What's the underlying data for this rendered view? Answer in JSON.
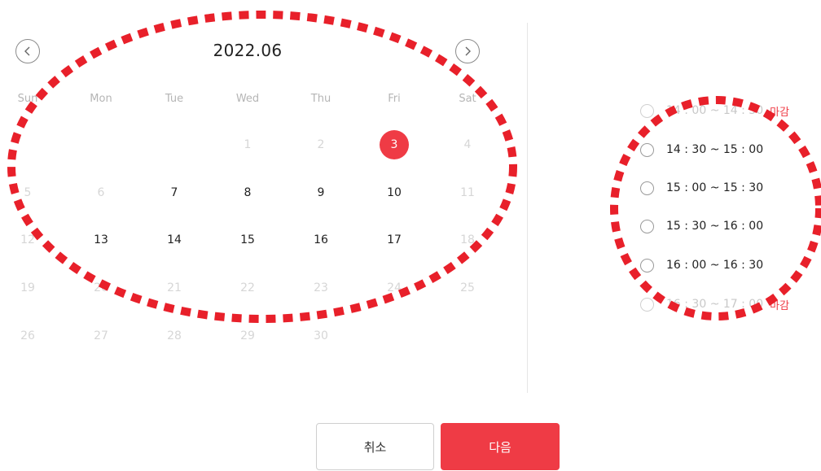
{
  "calendar": {
    "title": "2022.06",
    "weekdays": [
      "Sun",
      "Mon",
      "Tue",
      "Wed",
      "Thu",
      "Fri",
      "Sat"
    ],
    "weeks": [
      [
        {
          "label": "",
          "state": "empty"
        },
        {
          "label": "",
          "state": "empty"
        },
        {
          "label": "",
          "state": "empty"
        },
        {
          "label": "1",
          "state": "faded"
        },
        {
          "label": "2",
          "state": "faded"
        },
        {
          "label": "3",
          "state": "selected"
        },
        {
          "label": "4",
          "state": "faded"
        }
      ],
      [
        {
          "label": "5",
          "state": "faded"
        },
        {
          "label": "6",
          "state": "faded"
        },
        {
          "label": "7",
          "state": "active"
        },
        {
          "label": "8",
          "state": "active"
        },
        {
          "label": "9",
          "state": "active"
        },
        {
          "label": "10",
          "state": "active"
        },
        {
          "label": "11",
          "state": "faded"
        }
      ],
      [
        {
          "label": "12",
          "state": "faded"
        },
        {
          "label": "13",
          "state": "active"
        },
        {
          "label": "14",
          "state": "active"
        },
        {
          "label": "15",
          "state": "active"
        },
        {
          "label": "16",
          "state": "active"
        },
        {
          "label": "17",
          "state": "active"
        },
        {
          "label": "18",
          "state": "faded"
        }
      ],
      [
        {
          "label": "19",
          "state": "faded"
        },
        {
          "label": "20",
          "state": "faded"
        },
        {
          "label": "21",
          "state": "faded"
        },
        {
          "label": "22",
          "state": "faded"
        },
        {
          "label": "23",
          "state": "faded"
        },
        {
          "label": "24",
          "state": "faded"
        },
        {
          "label": "25",
          "state": "faded"
        }
      ],
      [
        {
          "label": "26",
          "state": "faded"
        },
        {
          "label": "27",
          "state": "faded"
        },
        {
          "label": "28",
          "state": "faded"
        },
        {
          "label": "29",
          "state": "faded"
        },
        {
          "label": "30",
          "state": "faded"
        },
        {
          "label": "",
          "state": "empty"
        },
        {
          "label": "",
          "state": "empty"
        }
      ]
    ],
    "prev_icon": "chevron-left-icon",
    "next_icon": "chevron-right-icon"
  },
  "time_slots": [
    {
      "label": "14 : 00 ~ 14 : 30",
      "closed": true,
      "tag": "마감"
    },
    {
      "label": "14 : 30 ~ 15 : 00",
      "closed": false,
      "tag": ""
    },
    {
      "label": "15 : 00 ~ 15 : 30",
      "closed": false,
      "tag": ""
    },
    {
      "label": "15 : 30 ~ 16 : 00",
      "closed": false,
      "tag": ""
    },
    {
      "label": "16 : 00 ~ 16 : 30",
      "closed": false,
      "tag": ""
    },
    {
      "label": "16 : 30 ~ 17 : 00",
      "closed": true,
      "tag": "마감"
    }
  ],
  "actions": {
    "cancel_label": "취소",
    "next_label": "다음"
  },
  "colors": {
    "accent": "#ef3b45",
    "annotation": "#e8202a"
  }
}
